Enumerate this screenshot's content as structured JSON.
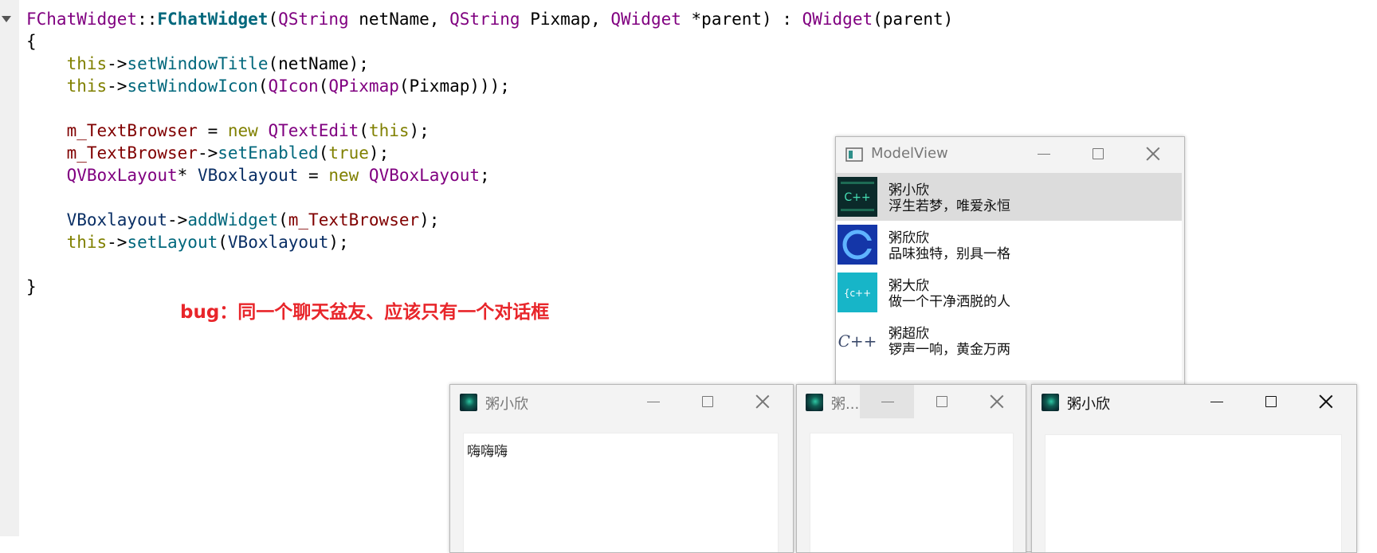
{
  "editor": {
    "lines": [
      [
        [
          "k-type",
          "FChatWidget"
        ],
        [
          "k-plain",
          "::"
        ],
        [
          "k-fnb",
          "FChatWidget"
        ],
        [
          "k-plain",
          "("
        ],
        [
          "k-type",
          "QString"
        ],
        [
          "k-plain",
          " netName, "
        ],
        [
          "k-type",
          "QString"
        ],
        [
          "k-plain",
          " Pixmap, "
        ],
        [
          "k-type",
          "QWidget"
        ],
        [
          "k-plain",
          " *parent) : "
        ],
        [
          "k-type",
          "QWidget"
        ],
        [
          "k-plain",
          "(parent)"
        ]
      ],
      [
        [
          "k-plain",
          "{"
        ]
      ],
      [
        [
          "k-plain",
          "    "
        ],
        [
          "k-kw",
          "this"
        ],
        [
          "k-plain",
          "->"
        ],
        [
          "k-fn",
          "setWindowTitle"
        ],
        [
          "k-plain",
          "(netName);"
        ]
      ],
      [
        [
          "k-plain",
          "    "
        ],
        [
          "k-kw",
          "this"
        ],
        [
          "k-plain",
          "->"
        ],
        [
          "k-fn",
          "setWindowIcon"
        ],
        [
          "k-plain",
          "("
        ],
        [
          "k-type",
          "QIcon"
        ],
        [
          "k-plain",
          "("
        ],
        [
          "k-type",
          "QPixmap"
        ],
        [
          "k-plain",
          "(Pixmap)));"
        ]
      ],
      [
        [
          "k-plain",
          ""
        ]
      ],
      [
        [
          "k-plain",
          "    "
        ],
        [
          "k-mem",
          "m_TextBrowser"
        ],
        [
          "k-plain",
          " = "
        ],
        [
          "k-kw",
          "new"
        ],
        [
          "k-plain",
          " "
        ],
        [
          "k-type",
          "QTextEdit"
        ],
        [
          "k-plain",
          "("
        ],
        [
          "k-kw",
          "this"
        ],
        [
          "k-plain",
          ");"
        ]
      ],
      [
        [
          "k-plain",
          "    "
        ],
        [
          "k-mem",
          "m_TextBrowser"
        ],
        [
          "k-plain",
          "->"
        ],
        [
          "k-fn",
          "setEnabled"
        ],
        [
          "k-plain",
          "("
        ],
        [
          "k-kw",
          "true"
        ],
        [
          "k-plain",
          ");"
        ]
      ],
      [
        [
          "k-plain",
          "    "
        ],
        [
          "k-type",
          "QVBoxLayout"
        ],
        [
          "k-plain",
          "* "
        ],
        [
          "k-var",
          "VBoxlayout"
        ],
        [
          "k-plain",
          " = "
        ],
        [
          "k-kw",
          "new"
        ],
        [
          "k-plain",
          " "
        ],
        [
          "k-type",
          "QVBoxLayout"
        ],
        [
          "k-plain",
          ";"
        ]
      ],
      [
        [
          "k-plain",
          ""
        ]
      ],
      [
        [
          "k-plain",
          "    "
        ],
        [
          "k-var",
          "VBoxlayout"
        ],
        [
          "k-plain",
          "->"
        ],
        [
          "k-fn",
          "addWidget"
        ],
        [
          "k-plain",
          "("
        ],
        [
          "k-mem",
          "m_TextBrowser"
        ],
        [
          "k-plain",
          ");"
        ]
      ],
      [
        [
          "k-plain",
          "    "
        ],
        [
          "k-kw",
          "this"
        ],
        [
          "k-plain",
          "->"
        ],
        [
          "k-fn",
          "setLayout"
        ],
        [
          "k-plain",
          "("
        ],
        [
          "k-var",
          "VBoxlayout"
        ],
        [
          "k-plain",
          ");"
        ]
      ],
      [
        [
          "k-plain",
          ""
        ]
      ],
      [
        [
          "k-plain",
          "}"
        ]
      ]
    ]
  },
  "annotation": {
    "text": "bug：同一个聊天盆友、应该只有一个对话框",
    "color": "#e8252a"
  },
  "model_view": {
    "title": "ModelView",
    "items": [
      {
        "name": "粥小欣",
        "signature": "浮生若梦，唯爱永恒",
        "icon": "cpp-green-avatar",
        "selected": true
      },
      {
        "name": "粥欣欣",
        "signature": "品味独特，别具一格",
        "icon": "cpp-blue-avatar",
        "selected": false
      },
      {
        "name": "粥大欣",
        "signature": "做一个干净洒脱的人",
        "icon": "cpp-cyan-avatar",
        "selected": false
      },
      {
        "name": "粥超欣",
        "signature": "锣声一响，黄金万两",
        "icon": "cpp-sketch-avatar",
        "selected": false
      }
    ]
  },
  "chat_windows": [
    {
      "title": "粥小欣",
      "content": "嗨嗨嗨",
      "active": false
    },
    {
      "title": "粥...",
      "content": "",
      "active": false
    },
    {
      "title": "粥小欣",
      "content": "",
      "active": true
    }
  ]
}
